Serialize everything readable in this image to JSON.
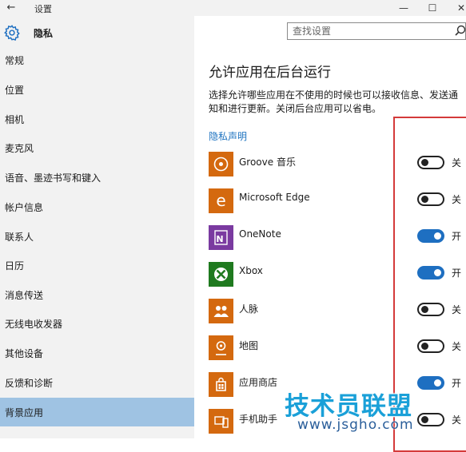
{
  "window": {
    "title": "设置",
    "back_icon": "←",
    "minimize_icon": "—",
    "maximize_icon": "☐",
    "close_icon": "✕"
  },
  "sidebar": {
    "header": "隐私",
    "items": [
      {
        "label": "常规"
      },
      {
        "label": "位置"
      },
      {
        "label": "相机"
      },
      {
        "label": "麦克风"
      },
      {
        "label": "语音、墨迹书写和键入"
      },
      {
        "label": "帐户信息"
      },
      {
        "label": "联系人"
      },
      {
        "label": "日历"
      },
      {
        "label": "消息传送"
      },
      {
        "label": "无线电收发器"
      },
      {
        "label": "其他设备"
      },
      {
        "label": "反馈和诊断"
      },
      {
        "label": "背景应用"
      }
    ],
    "selected_index": 12
  },
  "search": {
    "placeholder": "查找设置"
  },
  "main": {
    "title": "允许应用在后台运行",
    "description": "选择允许哪些应用在不使用的时候也可以接收信息、发送通知和进行更新。关闭后台应用可以省电。",
    "privacy_link": "隐私声明",
    "apps": [
      {
        "name": "Groove 音乐",
        "state": "关",
        "on": false,
        "icon": "groove-music-icon",
        "color": "#d4690f"
      },
      {
        "name": "Microsoft Edge",
        "state": "关",
        "on": false,
        "icon": "edge-icon",
        "color": "#d4690f"
      },
      {
        "name": "OneNote",
        "state": "开",
        "on": true,
        "icon": "onenote-icon",
        "color": "#7a3aa0"
      },
      {
        "name": "Xbox",
        "state": "开",
        "on": true,
        "icon": "xbox-icon",
        "color": "#1f7a1f"
      },
      {
        "name": "人脉",
        "state": "关",
        "on": false,
        "icon": "people-icon",
        "color": "#d4690f"
      },
      {
        "name": "地图",
        "state": "关",
        "on": false,
        "icon": "maps-icon",
        "color": "#d4690f"
      },
      {
        "name": "应用商店",
        "state": "开",
        "on": true,
        "icon": "store-icon",
        "color": "#d4690f"
      },
      {
        "name": "手机助手",
        "state": "关",
        "on": false,
        "icon": "phone-companion-icon",
        "color": "#d4690f"
      }
    ]
  },
  "watermark": {
    "text": "技术员联盟",
    "url": "www.jsgho.com"
  },
  "colors": {
    "accent": "#1e6fc1",
    "sidebar_bg": "#f2f2f2",
    "selected_bg": "#9fc3e3",
    "highlight_box": "#d43a3a",
    "link": "#1e73c0"
  }
}
